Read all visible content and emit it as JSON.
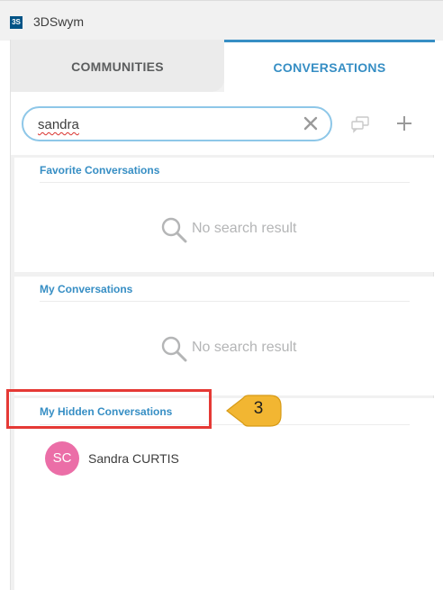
{
  "app": {
    "title": "3DSwym",
    "logo_text": "3S"
  },
  "tabs": [
    {
      "label": "COMMUNITIES",
      "active": false
    },
    {
      "label": "CONVERSATIONS",
      "active": true
    }
  ],
  "search": {
    "value": "sandra"
  },
  "sections": {
    "favorite": {
      "title": "Favorite Conversations",
      "empty_text": "No search result"
    },
    "my": {
      "title": "My Conversations",
      "empty_text": "No search result"
    },
    "hidden": {
      "title": "My Hidden Conversations",
      "items": [
        {
          "initials": "SC",
          "name": "Sandra CURTIS"
        }
      ]
    }
  },
  "annotation": {
    "step_number": "3"
  },
  "colors": {
    "accent": "#368ec4",
    "highlight_box": "#e53935",
    "callout_fill": "#f2b632",
    "avatar": "#eb6ea7"
  }
}
